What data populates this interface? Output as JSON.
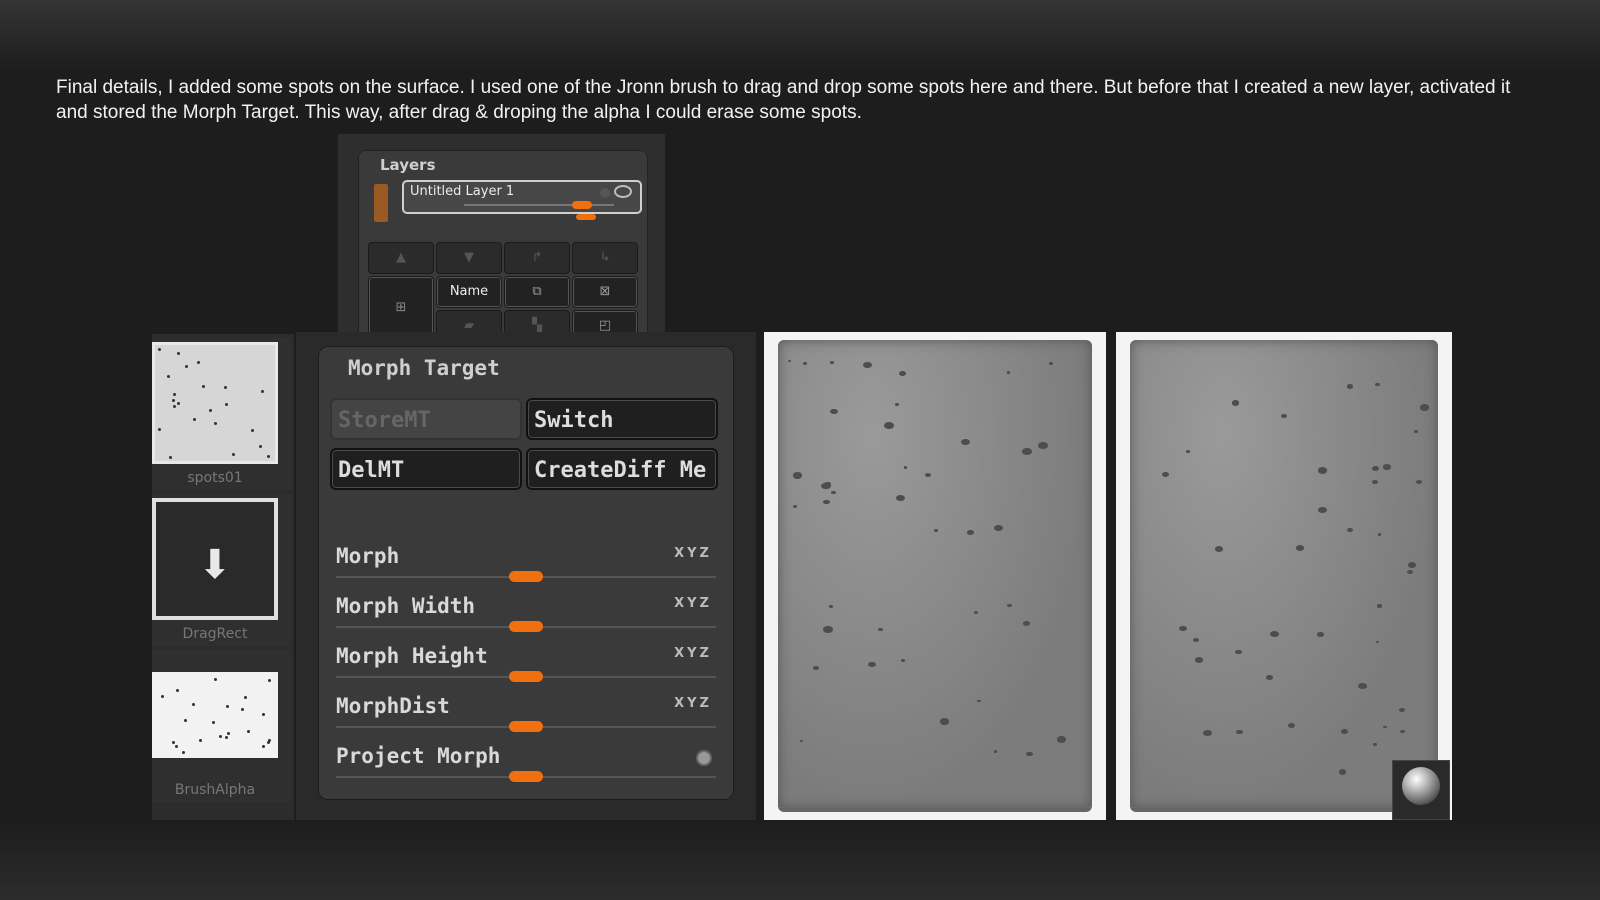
{
  "caption": "Final details, I added some spots on the surface. I used one of the Jronn brush to drag and drop some spots here and there. But before that I created a new layer, activated it and stored the Morph Target. This way, after drag & droping the alpha I could erase some spots.",
  "layers": {
    "title": "Layers",
    "layer_name": "Untitled  Layer 1",
    "name_button": "Name"
  },
  "thumbs": [
    {
      "label": "spots01"
    },
    {
      "label": "DragRect"
    },
    {
      "label": "BrushAlpha"
    }
  ],
  "morph": {
    "title": "Morph Target",
    "buttons": {
      "store": "StoreMT",
      "switch": "Switch",
      "del": "DelMT",
      "creatediff": "CreateDiff Me"
    },
    "sliders": [
      {
        "label": "Morph",
        "xyz": "XYZ",
        "value": 0.5
      },
      {
        "label": "Morph Width",
        "xyz": "XYZ",
        "value": 0.5
      },
      {
        "label": "Morph Height",
        "xyz": "XYZ",
        "value": 0.5
      },
      {
        "label": "MorphDist",
        "xyz": "XYZ",
        "value": 0.5
      },
      {
        "label": "Project Morph",
        "value": 0.5
      }
    ]
  },
  "colors": {
    "accent": "#f07010",
    "layer_color": "#9a5a24"
  },
  "icons": [
    "arrow-up-icon",
    "arrow-down-icon",
    "redo-icon",
    "forward-icon",
    "new-layer-icon",
    "duplicate-icon",
    "delete-icon",
    "merge-icon",
    "split-icon",
    "copy-icon",
    "drag-arrow-icon",
    "matcap-icon"
  ]
}
